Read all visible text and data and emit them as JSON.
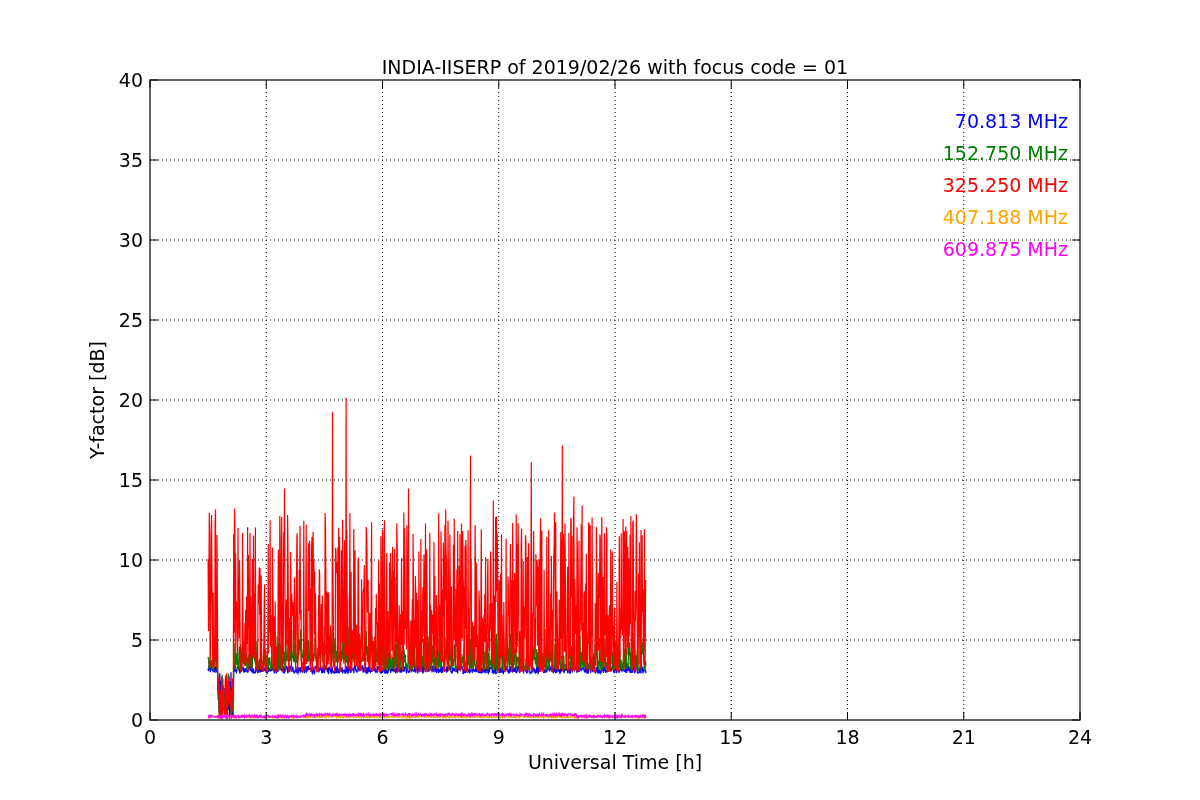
{
  "plot": {
    "title": "INDIA-IISERP of 2019/02/26 with focus code = 01",
    "xlabel": "Universal Time [h]",
    "ylabel": "Y-factor [dB]",
    "xticks": [
      "0",
      "3",
      "6",
      "9",
      "12",
      "15",
      "18",
      "21",
      "24"
    ],
    "yticks": [
      "40",
      "35",
      "30",
      "25",
      "20",
      "15",
      "10",
      "5",
      "0"
    ],
    "legend": [
      {
        "label": "70.813 MHz",
        "color": "#0000ff"
      },
      {
        "label": "152.750 MHz",
        "color": "#008000"
      },
      {
        "label": "325.250 MHz",
        "color": "#ff0000"
      },
      {
        "label": "407.188 MHz",
        "color": "#ffa500"
      },
      {
        "label": "609.875 MHz",
        "color": "#ff00ff"
      }
    ]
  }
}
